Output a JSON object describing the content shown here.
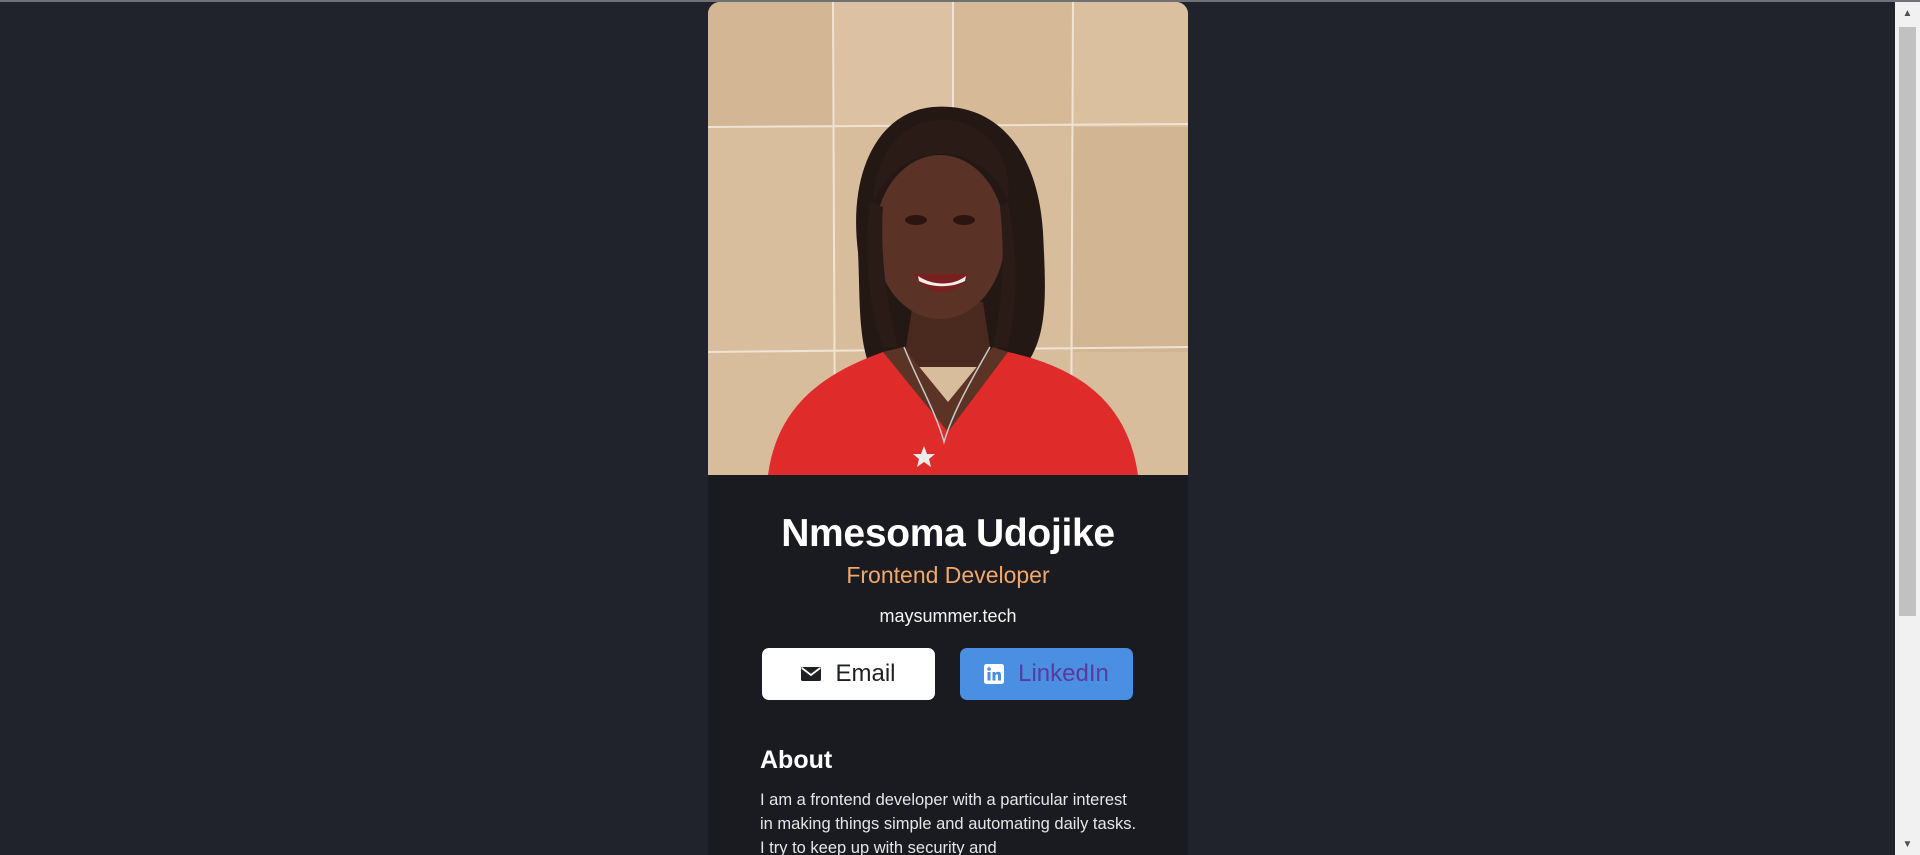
{
  "profile": {
    "name": "Nmesoma Udojike",
    "role": "Frontend Developer",
    "website": "maysummer.tech",
    "photo_alt": "Nmesoma Udojike"
  },
  "buttons": {
    "email": {
      "label": "Email",
      "icon": "mail-icon"
    },
    "linkedin": {
      "label": "LinkedIn",
      "icon": "linkedin-icon"
    }
  },
  "about": {
    "heading": "About",
    "text": "I am a frontend developer with a particular interest in making things simple and automating daily tasks. I try to keep up with security and"
  },
  "colors": {
    "page_bg": "#20232b",
    "card_bg": "#1a1b20",
    "accent_title": "#f2a86a",
    "linkedin_button": "#4a8fe2",
    "email_button": "#ffffff"
  }
}
